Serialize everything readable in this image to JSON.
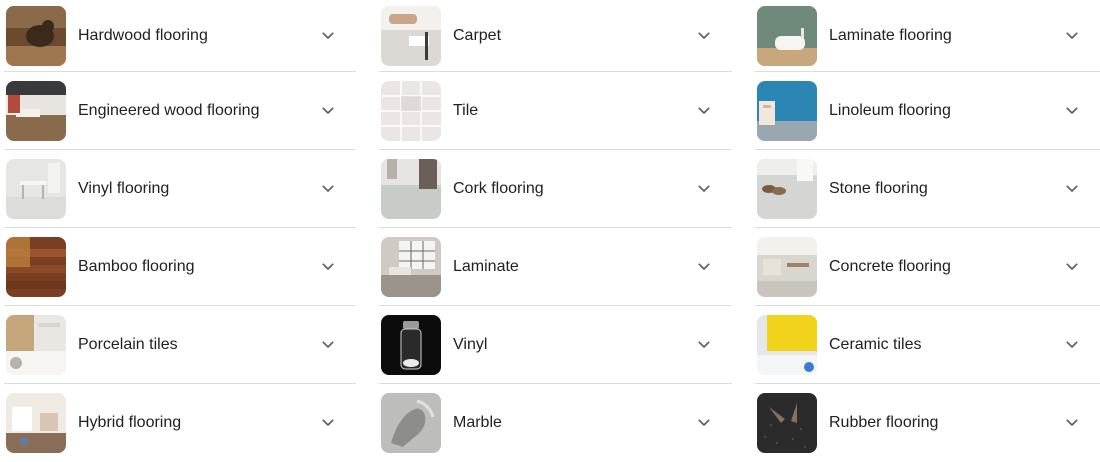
{
  "columns": [
    {
      "items": [
        {
          "label": "Hardwood flooring",
          "thumb": "wood-floor-dog",
          "bg": "#6b4a2e",
          "accent": "#3a2a1c"
        },
        {
          "label": "Engineered wood flooring",
          "thumb": "wood-living-room",
          "bg": "#c9b79f",
          "accent": "#8a6a4c"
        },
        {
          "label": "Vinyl flooring",
          "thumb": "white-room-table",
          "bg": "#e6e6e4",
          "accent": "#c8c4bd"
        },
        {
          "label": "Bamboo flooring",
          "thumb": "bamboo-boards",
          "bg": "#7a3e22",
          "accent": "#b87d3c"
        },
        {
          "label": "Porcelain tiles",
          "thumb": "kitchen",
          "bg": "#e9e7e3",
          "accent": "#c5a57a"
        },
        {
          "label": "Hybrid flooring",
          "thumb": "kids-room",
          "bg": "#efeae4",
          "accent": "#8a6d58"
        }
      ]
    },
    {
      "items": [
        {
          "label": "Carpet",
          "thumb": "carpet-feet",
          "bg": "#dcd9d5",
          "accent": "#3f3a36"
        },
        {
          "label": "Tile",
          "thumb": "white-tiles",
          "bg": "#ebe6e5",
          "accent": "#d8d1cf"
        },
        {
          "label": "Cork flooring",
          "thumb": "cork-grey-floor",
          "bg": "#c8ccc9",
          "accent": "#6b5f5a"
        },
        {
          "label": "Laminate",
          "thumb": "loft-window",
          "bg": "#cfcac3",
          "accent": "#8f8a83"
        },
        {
          "label": "Vinyl",
          "thumb": "glass-vial",
          "bg": "#0c0c0c",
          "accent": "#cfcfcf"
        },
        {
          "label": "Marble",
          "thumb": "marble-relief",
          "bg": "#bdbdbb",
          "accent": "#8d8d8b"
        }
      ]
    },
    {
      "items": [
        {
          "label": "Laminate flooring",
          "thumb": "green-bathroom",
          "bg": "#6f8a7a",
          "accent": "#c9a77c"
        },
        {
          "label": "Linoleum flooring",
          "thumb": "blue-wall",
          "bg": "#2c86b3",
          "accent": "#9aa7b0"
        },
        {
          "label": "Stone flooring",
          "thumb": "grey-floor-shoes",
          "bg": "#d5d6d4",
          "accent": "#7a5a42"
        },
        {
          "label": "Concrete flooring",
          "thumb": "office-space",
          "bg": "#d9d6d0",
          "accent": "#a0826a"
        },
        {
          "label": "Ceramic tiles",
          "thumb": "yellow-wall",
          "bg": "#f2d31b",
          "accent": "#e5e7ea"
        },
        {
          "label": "Rubber flooring",
          "thumb": "rubber-mat-hands",
          "bg": "#2b2b2b",
          "accent": "#8a6f5e"
        }
      ]
    }
  ],
  "colors": {
    "divider": "#dadce0",
    "text": "#202124",
    "chevron": "#5f6368"
  },
  "icons": {
    "expand": "chevron-down-icon"
  }
}
